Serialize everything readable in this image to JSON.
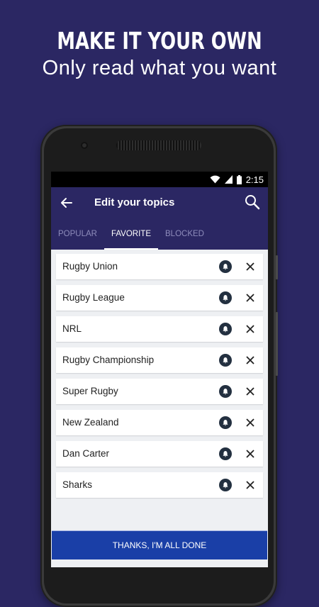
{
  "promo": {
    "headline": "MAKE IT YOUR OWN",
    "subline": "Only read what you want"
  },
  "status_bar": {
    "time": "2:15",
    "icons": [
      "wifi-icon",
      "signal-icon",
      "battery-icon"
    ]
  },
  "app_bar": {
    "title": "Edit your topics",
    "back_icon": "arrow-left-icon",
    "search_icon": "search-icon"
  },
  "tabs": [
    {
      "label": "POPULAR",
      "active": false
    },
    {
      "label": "FAVORITE",
      "active": true
    },
    {
      "label": "BLOCKED",
      "active": false
    }
  ],
  "topics": [
    {
      "label": "Rugby Union"
    },
    {
      "label": "Rugby League"
    },
    {
      "label": "NRL"
    },
    {
      "label": "Rugby Championship"
    },
    {
      "label": "Super Rugby"
    },
    {
      "label": "New Zealand"
    },
    {
      "label": "Dan Carter"
    },
    {
      "label": "Sharks"
    }
  ],
  "done_button": {
    "label": "THANKS, I'M ALL DONE"
  },
  "colors": {
    "brand": "#2b2763",
    "button": "#1a3fa7",
    "bell": "#233040"
  }
}
